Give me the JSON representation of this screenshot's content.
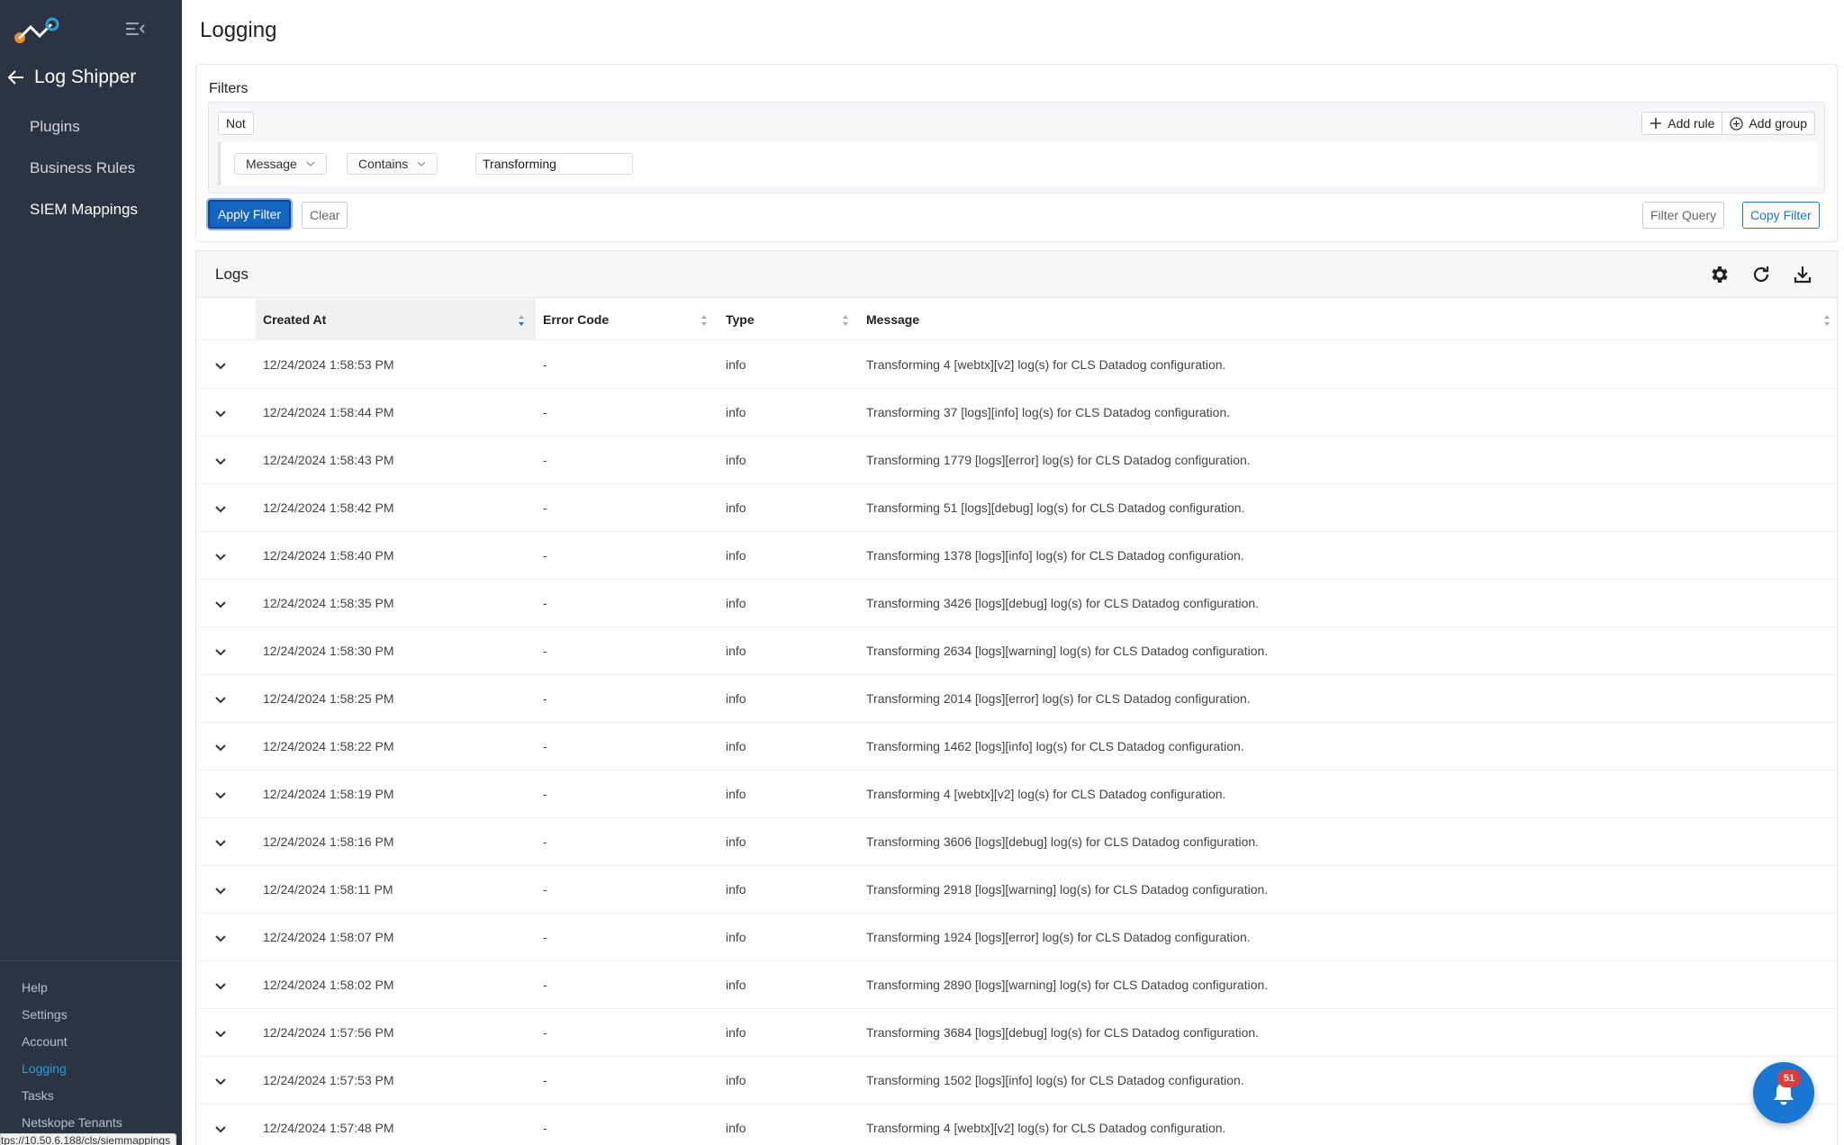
{
  "sidebar": {
    "back_label": "Log Shipper",
    "nav": [
      "Plugins",
      "Business Rules",
      "SIEM Mappings"
    ],
    "active_nav": "SIEM Mappings",
    "bottom": [
      "Help",
      "Settings",
      "Account",
      "Logging",
      "Tasks",
      "Netskope Tenants"
    ],
    "active_bottom": "Logging"
  },
  "page": {
    "title": "Logging"
  },
  "filters": {
    "label": "Filters",
    "not_label": "Not",
    "add_rule": "Add rule",
    "add_group": "Add group",
    "field": "Message",
    "operator": "Contains",
    "value": "Transforming",
    "apply": "Apply Filter",
    "clear": "Clear",
    "filter_query": "Filter Query",
    "copy_filter": "Copy Filter"
  },
  "logs": {
    "title": "Logs",
    "columns": [
      "Created At",
      "Error Code",
      "Type",
      "Message"
    ],
    "sorted_column": "Created At",
    "rows": [
      {
        "created_at": "12/24/2024 1:58:53 PM",
        "error_code": "-",
        "type": "info",
        "message": "Transforming 4 [webtx][v2] log(s) for CLS Datadog configuration."
      },
      {
        "created_at": "12/24/2024 1:58:44 PM",
        "error_code": "-",
        "type": "info",
        "message": "Transforming 37 [logs][info] log(s) for CLS Datadog configuration."
      },
      {
        "created_at": "12/24/2024 1:58:43 PM",
        "error_code": "-",
        "type": "info",
        "message": "Transforming 1779 [logs][error] log(s) for CLS Datadog configuration."
      },
      {
        "created_at": "12/24/2024 1:58:42 PM",
        "error_code": "-",
        "type": "info",
        "message": "Transforming 51 [logs][debug] log(s) for CLS Datadog configuration."
      },
      {
        "created_at": "12/24/2024 1:58:40 PM",
        "error_code": "-",
        "type": "info",
        "message": "Transforming 1378 [logs][info] log(s) for CLS Datadog configuration."
      },
      {
        "created_at": "12/24/2024 1:58:35 PM",
        "error_code": "-",
        "type": "info",
        "message": "Transforming 3426 [logs][debug] log(s) for CLS Datadog configuration."
      },
      {
        "created_at": "12/24/2024 1:58:30 PM",
        "error_code": "-",
        "type": "info",
        "message": "Transforming 2634 [logs][warning] log(s) for CLS Datadog configuration."
      },
      {
        "created_at": "12/24/2024 1:58:25 PM",
        "error_code": "-",
        "type": "info",
        "message": "Transforming 2014 [logs][error] log(s) for CLS Datadog configuration."
      },
      {
        "created_at": "12/24/2024 1:58:22 PM",
        "error_code": "-",
        "type": "info",
        "message": "Transforming 1462 [logs][info] log(s) for CLS Datadog configuration."
      },
      {
        "created_at": "12/24/2024 1:58:19 PM",
        "error_code": "-",
        "type": "info",
        "message": "Transforming 4 [webtx][v2] log(s) for CLS Datadog configuration."
      },
      {
        "created_at": "12/24/2024 1:58:16 PM",
        "error_code": "-",
        "type": "info",
        "message": "Transforming 3606 [logs][debug] log(s) for CLS Datadog configuration."
      },
      {
        "created_at": "12/24/2024 1:58:11 PM",
        "error_code": "-",
        "type": "info",
        "message": "Transforming 2918 [logs][warning] log(s) for CLS Datadog configuration."
      },
      {
        "created_at": "12/24/2024 1:58:07 PM",
        "error_code": "-",
        "type": "info",
        "message": "Transforming 1924 [logs][error] log(s) for CLS Datadog configuration."
      },
      {
        "created_at": "12/24/2024 1:58:02 PM",
        "error_code": "-",
        "type": "info",
        "message": "Transforming 2890 [logs][warning] log(s) for CLS Datadog configuration."
      },
      {
        "created_at": "12/24/2024 1:57:56 PM",
        "error_code": "-",
        "type": "info",
        "message": "Transforming 3684 [logs][debug] log(s) for CLS Datadog configuration."
      },
      {
        "created_at": "12/24/2024 1:57:53 PM",
        "error_code": "-",
        "type": "info",
        "message": "Transforming 1502 [logs][info] log(s) for CLS Datadog configuration."
      },
      {
        "created_at": "12/24/2024 1:57:48 PM",
        "error_code": "-",
        "type": "info",
        "message": "Transforming 4 [webtx][v2] log(s) for CLS Datadog configuration."
      }
    ]
  },
  "status_bar": {
    "url": "tps://10.50.6.188/cls/siemmappings"
  },
  "notifications": {
    "count": "51"
  },
  "colors": {
    "sidebar_bg": "#2a3442",
    "accent": "#1976d2",
    "active_link": "#2f9bd8",
    "badge": "#e53935"
  },
  "icons": [
    "logo-icon",
    "menu-collapse-icon",
    "back-arrow-icon",
    "plus-icon",
    "add-circle-icon",
    "chevron-down-icon",
    "gear-icon",
    "refresh-icon",
    "download-icon",
    "sort-icon",
    "bell-icon"
  ]
}
